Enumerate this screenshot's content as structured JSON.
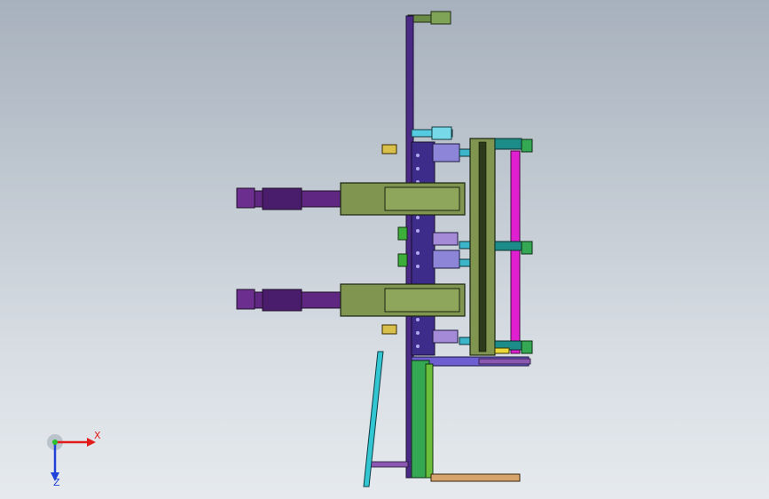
{
  "viewport": {
    "background_top": "#a7b1bd",
    "background_bottom": "#e6eaee"
  },
  "triad": {
    "x_label": "X",
    "z_label": "Z",
    "x_color": "#e21b1b",
    "y_color": "#27c12b",
    "z_color": "#2042d8"
  },
  "part_colors": {
    "frame_purple": "#4b2a86",
    "cylinder_purple": "#6c2f8f",
    "olive_block": "#7f9550",
    "green_bar": "#2f9a3a",
    "magenta_rail": "#e01fd0",
    "cyan_strut": "#32c6d3",
    "teal": "#1c8c88",
    "lavender": "#8d86d8",
    "orange_rod": "#d7a46b",
    "yellow": "#e9d93a"
  }
}
